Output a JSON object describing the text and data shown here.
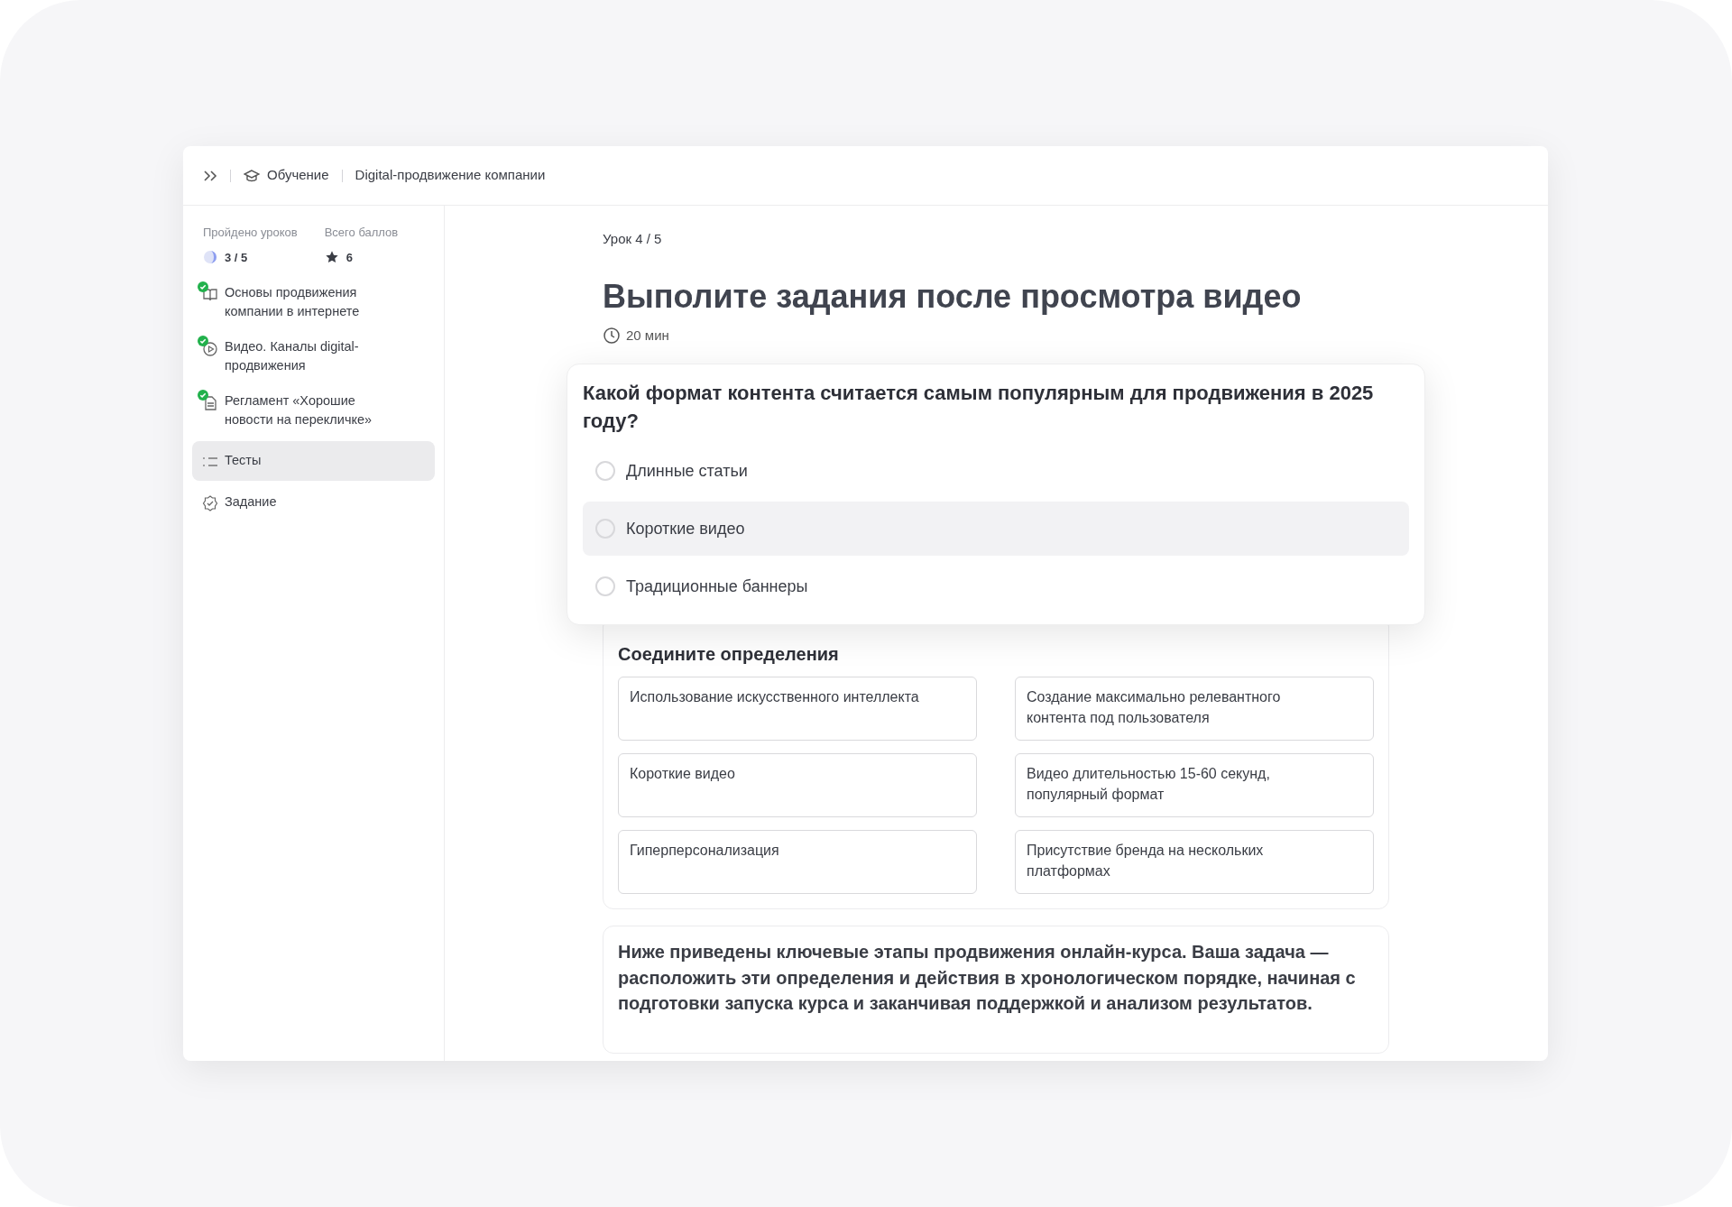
{
  "breadcrumbs": [
    {
      "kind": "section",
      "label": "Обучение"
    },
    {
      "kind": "course",
      "label": "Digital-продвижение компании"
    }
  ],
  "stats": {
    "lessons_label": "Пройдено уроков",
    "lessons_value": "3 / 5",
    "points_label": "Всего баллов",
    "points_value": "6"
  },
  "sidebar": {
    "items": [
      {
        "kind": "book",
        "label": "Основы продвижения компании в интернете",
        "completed": true,
        "selected": false
      },
      {
        "kind": "video",
        "label": "Видео. Каналы digital-продвижения",
        "completed": true,
        "selected": false
      },
      {
        "kind": "document",
        "label": "Регламент «Хорошие новости на перекличке»",
        "completed": true,
        "selected": false
      },
      {
        "kind": "list",
        "label": "Тесты",
        "completed": false,
        "selected": true
      },
      {
        "kind": "task",
        "label": "Задание",
        "completed": false,
        "selected": false
      }
    ]
  },
  "lesson": {
    "counter": "Урок 4 / 5",
    "title": "Выполите задания после просмотра видео",
    "duration": "20 мин"
  },
  "question": {
    "text": "Какой формат контента считается самым популярным для продвижения в 2025 году?",
    "options": [
      {
        "label": "Длинные статьи",
        "selected": false,
        "highlighted": false
      },
      {
        "label": "Короткие видео",
        "selected": false,
        "highlighted": true
      },
      {
        "label": "Традиционные баннеры",
        "selected": false,
        "highlighted": false
      }
    ]
  },
  "matching": {
    "title": "Соедините определения",
    "pairs": [
      {
        "term": "Использование искусственного интеллекта",
        "definition": "Создание максимально релевантного контента под пользователя"
      },
      {
        "term": "Короткие видео",
        "definition": "Видео длительностью 15-60 секунд, популярный формат"
      },
      {
        "term": "Гиперперсонализация",
        "definition": "Присутствие бренда на нескольких платформах"
      }
    ]
  },
  "ordering": {
    "text": "Ниже приведены ключевые этапы продвижения онлайн-курса. Ваша задача — расположить эти определения и действия в хронологическом порядке, начиная с подготовки запуска курса и заканчивая поддержкой и анализом результатов."
  }
}
